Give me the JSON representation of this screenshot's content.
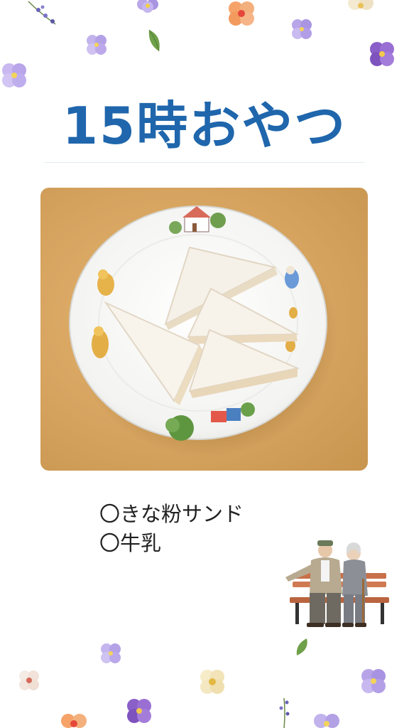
{
  "header": {
    "title": "15時おやつ"
  },
  "menu": {
    "items": [
      "〇きな粉サンド",
      "〇牛乳"
    ]
  },
  "colors": {
    "title": "#1f66ac",
    "background": "#ffffff",
    "photo_table": "#d6a45f"
  },
  "decorations": [
    "flower-icon",
    "leaf-icon",
    "elderly-couple-on-bench-illustration",
    "sandwich-plate-photo"
  ]
}
